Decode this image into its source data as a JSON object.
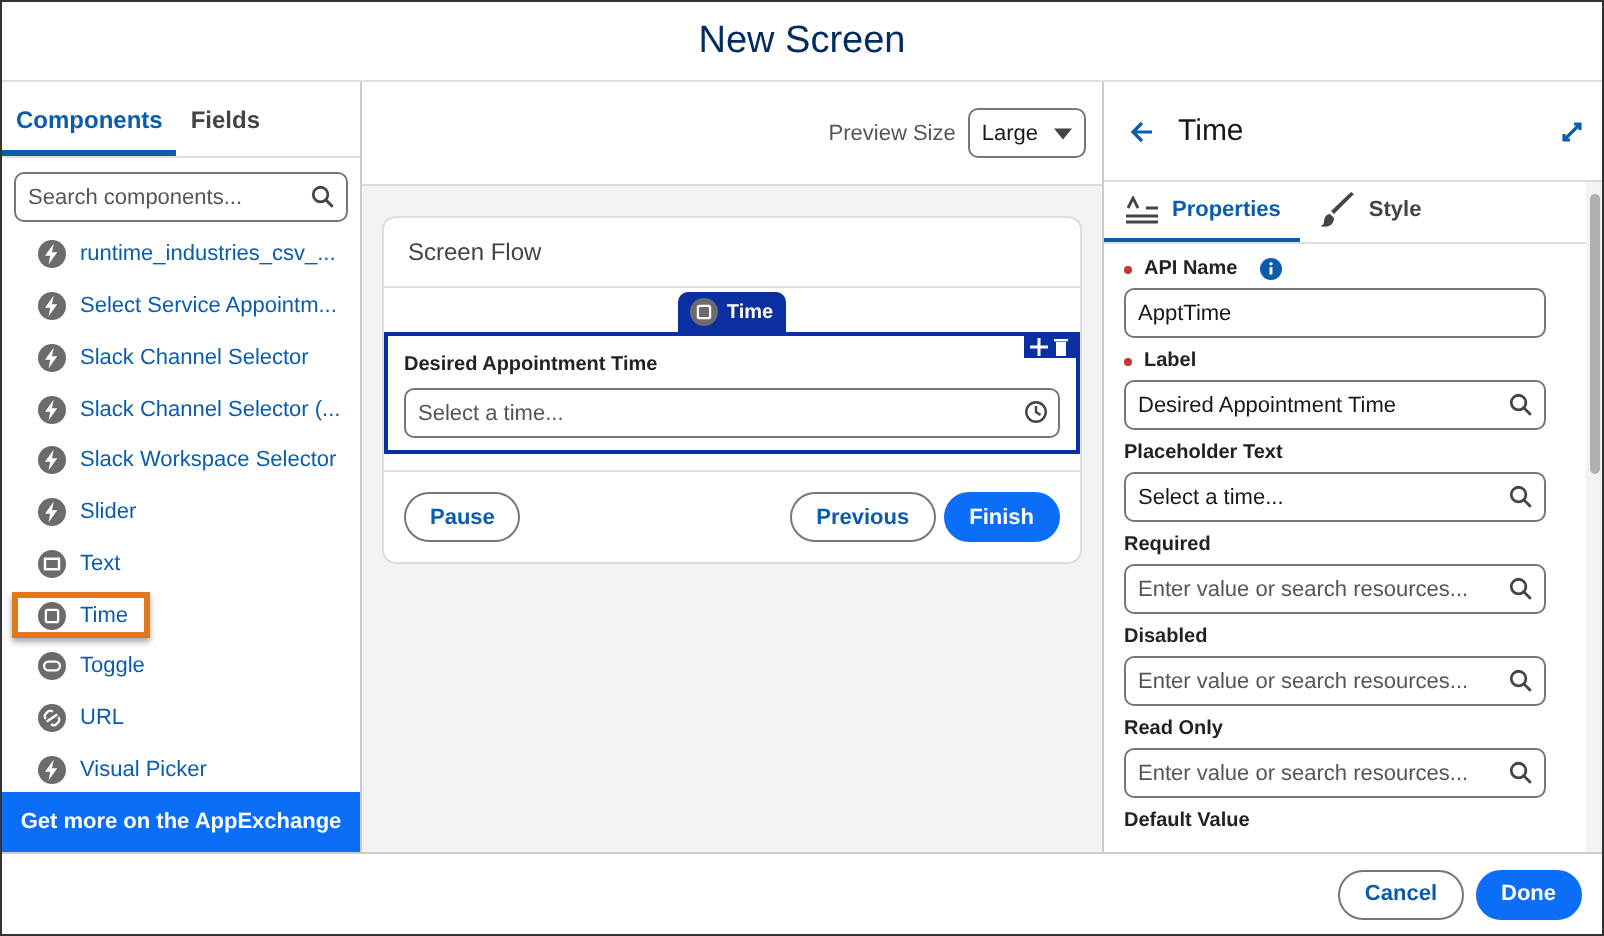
{
  "window": {
    "title": "New Screen"
  },
  "left_tabs": [
    {
      "label": "Components",
      "selected": true
    },
    {
      "label": "Fields",
      "selected": false
    }
  ],
  "search": {
    "placeholder": "Search components..."
  },
  "components": [
    {
      "label": "runtime_industries_csv_...",
      "kind": "bolt",
      "selected": false
    },
    {
      "label": "Select Service Appointm...",
      "kind": "bolt",
      "selected": false
    },
    {
      "label": "Slack Channel Selector",
      "kind": "bolt",
      "selected": false
    },
    {
      "label": "Slack Channel Selector (...",
      "kind": "bolt",
      "selected": false
    },
    {
      "label": "Slack Workspace Selector",
      "kind": "bolt",
      "selected": false
    },
    {
      "label": "Slider",
      "kind": "bolt",
      "selected": false
    },
    {
      "label": "Text",
      "kind": "text",
      "selected": false
    },
    {
      "label": "Time",
      "kind": "time",
      "selected": true
    },
    {
      "label": "Toggle",
      "kind": "toggle",
      "selected": false
    },
    {
      "label": "URL",
      "kind": "url",
      "selected": false
    },
    {
      "label": "Visual Picker",
      "kind": "bolt",
      "selected": false
    }
  ],
  "appexchange": "Get more on the AppExchange",
  "preview": {
    "label": "Preview Size",
    "value": "Large"
  },
  "canvas": {
    "title": "Screen Flow",
    "tag": "Time",
    "field_label": "Desired Appointment Time",
    "placeholder": "Select a time...",
    "buttons": [
      {
        "label": "Pause",
        "kind": "outline"
      },
      {
        "label": "Previous",
        "kind": "outline"
      },
      {
        "label": "Finish",
        "kind": "brand"
      }
    ]
  },
  "properties": {
    "title": "Time",
    "tabs": [
      {
        "label": "Properties",
        "kind": "lines",
        "selected": true
      },
      {
        "label": "Style",
        "kind": "brush",
        "selected": false
      }
    ],
    "fields": [
      {
        "label": "API Name",
        "required": true,
        "info": true,
        "value": "ApptTime",
        "search": false
      },
      {
        "label": "Label",
        "required": true,
        "info": false,
        "value": "Desired Appointment Time",
        "search": true
      },
      {
        "label": "Placeholder Text",
        "required": false,
        "info": false,
        "value": "Select a time...",
        "search": true
      },
      {
        "label": "Required",
        "required": false,
        "info": false,
        "placeholder": "Enter value or search resources...",
        "search": true
      },
      {
        "label": "Disabled",
        "required": false,
        "info": false,
        "placeholder": "Enter value or search resources...",
        "search": true
      },
      {
        "label": "Read Only",
        "required": false,
        "info": false,
        "placeholder": "Enter value or search resources...",
        "search": true
      }
    ],
    "next_label": "Default Value"
  },
  "footer": {
    "buttons": [
      {
        "label": "Cancel",
        "kind": "outline"
      },
      {
        "label": "Done",
        "kind": "brand"
      }
    ]
  }
}
